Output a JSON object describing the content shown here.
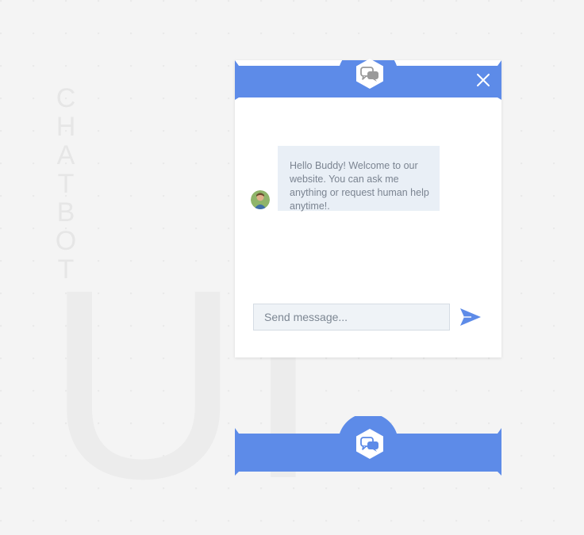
{
  "background": {
    "vertical_text": "CHATBOT",
    "large_text": "UI"
  },
  "colors": {
    "brand": "#5d8be8",
    "bubble_bg": "#e9eff6",
    "bubble_text": "#7b8491",
    "background": "#f4f4f4"
  },
  "chat": {
    "header": {
      "logo_icon": "chat-bubbles-icon",
      "close_icon": "close-icon"
    },
    "messages": [
      {
        "sender": "bot",
        "avatar_icon": "avatar",
        "text": "Hello Buddy! Welcome to our website. You can ask me anything or request human help anytime!."
      }
    ],
    "input": {
      "placeholder": "Send message...",
      "value": ""
    },
    "send_icon": "send-icon"
  },
  "launcher": {
    "logo_icon": "chat-bubbles-icon"
  }
}
